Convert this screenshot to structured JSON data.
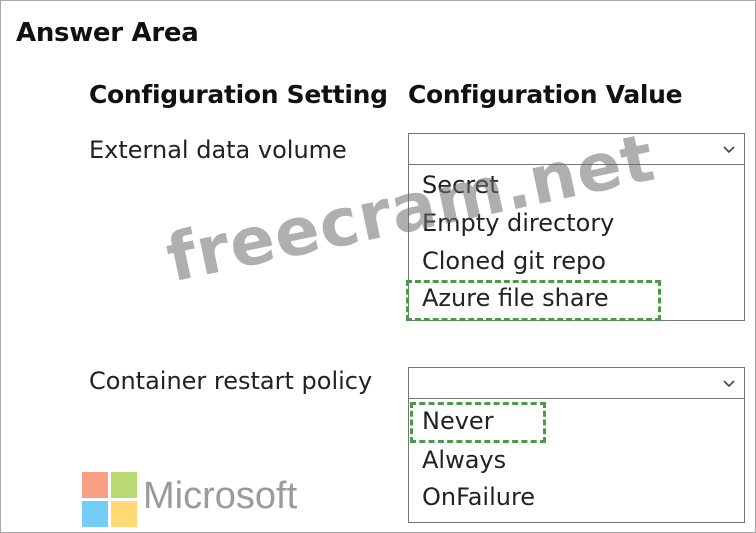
{
  "title": "Answer Area",
  "columns": {
    "setting": "Configuration Setting",
    "value": "Configuration Value"
  },
  "rows": [
    {
      "label": "External data volume",
      "dropdown_value": "",
      "options": [
        "Secret",
        "Empty directory",
        "Cloned git repo",
        "Azure file share"
      ],
      "selected": "Azure file share"
    },
    {
      "label": "Container restart policy",
      "dropdown_value": "",
      "options": [
        "Never",
        "Always",
        "OnFailure"
      ],
      "selected": "Never"
    }
  ],
  "watermark": "freecram.net",
  "branding": {
    "name": "Microsoft",
    "logo_colors": [
      "#f25022",
      "#7fba00",
      "#00a4ef",
      "#ffb900"
    ]
  },
  "colors": {
    "selection_border": "#4a9a4a",
    "border": "#777777"
  },
  "icons": {
    "dropdown": "chevron-down-icon"
  }
}
